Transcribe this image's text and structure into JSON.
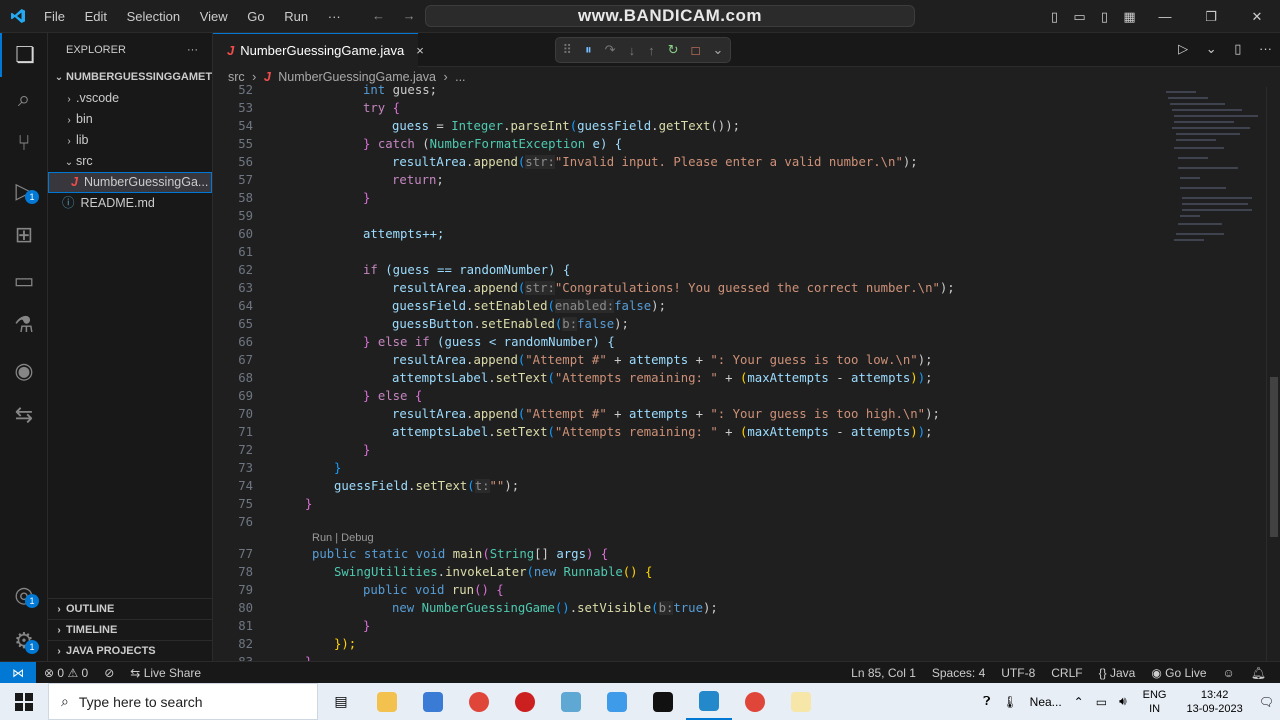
{
  "menu": [
    "File",
    "Edit",
    "Selection",
    "View",
    "Go",
    "Run"
  ],
  "menu_more": "···",
  "command_center": "www.BANDICAM.com",
  "explorer": {
    "title": "EXPLORER",
    "more": "···",
    "root": "NUMBERGUESSINGGAMETW",
    "items": [
      ".vscode",
      "bin",
      "lib",
      "src",
      "NumberGuessingGa...",
      "README.md"
    ],
    "panels": [
      "OUTLINE",
      "TIMELINE",
      "JAVA PROJECTS"
    ]
  },
  "tab": {
    "icon": "J",
    "label": "NumberGuessingGame.java",
    "close": "×"
  },
  "breadcrumb": {
    "folder": "src",
    "sep": "›",
    "file": "NumberGuessingGame.java",
    "more": "..."
  },
  "code_lens": "Run | Debug",
  "line_numbers": [
    "52",
    "53",
    "54",
    "55",
    "56",
    "57",
    "58",
    "59",
    "60",
    "61",
    "62",
    "63",
    "64",
    "65",
    "66",
    "67",
    "68",
    "69",
    "70",
    "71",
    "72",
    "73",
    "74",
    "75",
    "76",
    "77",
    "78",
    "79",
    "80",
    "81",
    "82",
    "83"
  ],
  "code": {
    "l52a": "int",
    "l52b": " guess;",
    "l53": "try",
    "l53b": " {",
    "l54a": "guess",
    "l54b": " = ",
    "l54c": "Integer",
    "l54d": ".",
    "l54e": "parseInt",
    "l54f": "(",
    "l54g": "guessField",
    "l54h": ".",
    "l54i": "getText",
    "l54j": "());",
    "l55a": "} ",
    "l55b": "catch",
    "l55c": " (",
    "l55d": "NumberFormatException",
    "l55e": " e) {",
    "resultArea": "resultArea",
    "append": "append",
    "dot": ".",
    "hint_str": "str:",
    "s56": "\"Invalid input. Please enter a valid number.\\n\"",
    "close_paren": ");",
    "l57": "return",
    "semi": ";",
    "rbrace": "}",
    "lbrace": "{",
    "l60": "attempts++;",
    "l62a": "if",
    "l62b": " (guess == randomNumber) {",
    "s63": "\"Congratulations! You guessed the correct number.\\n\"",
    "guessField": "guessField",
    "setEnabled": "setEnabled",
    "hint_enabled": "enabled:",
    "false": "false",
    "guessButton": "guessButton",
    "hint_b": "b:",
    "l66a": "} ",
    "l66b": "else if",
    "l66c": " (guess < randomNumber) {",
    "s_attempt": "\"Attempt #\"",
    "plus": " + ",
    "attempts": "attempts",
    "s67": "\": Your guess is too low.\\n\"",
    "attemptsLabel": "attemptsLabel",
    "setText": "setText",
    "s_rem": "\"Attempts remaining: \"",
    "maxAttempts": "maxAttempts",
    "minus": " - ",
    "l69a": "} ",
    "l69b": "else",
    "l69c": " {",
    "s70": "\": Your guess is too high.\\n\"",
    "hint_t": "t:",
    "empty": "\"\"",
    "public": "public",
    "static": "static",
    "void": "void",
    "main": "main",
    "String": "String",
    "args": "args",
    "SwingUtilities": "SwingUtilities",
    "invokeLater": "invokeLater",
    "new": "new",
    "Runnable": "Runnable",
    "run": "run",
    "NumberGuessingGame": "NumberGuessingGame",
    "setVisible": "setVisible",
    "true": "true",
    "l82": "});"
  },
  "status": {
    "errors": "0",
    "warnings": "0",
    "live_share": "Live Share",
    "position": "Ln 85, Col 1",
    "spaces": "Spaces: 4",
    "encoding": "UTF-8",
    "eol": "CRLF",
    "language": "Java",
    "go_live": "Go Live"
  },
  "taskbar": {
    "search_placeholder": "Type here to search",
    "weather": "Nea...",
    "lang_top": "ENG",
    "lang_bottom": "IN",
    "time": "13:42",
    "date": "13-09-2023"
  },
  "colors": {
    "accent": "#0078d4",
    "background": "#1f1f1f",
    "sidebar": "#181818"
  }
}
